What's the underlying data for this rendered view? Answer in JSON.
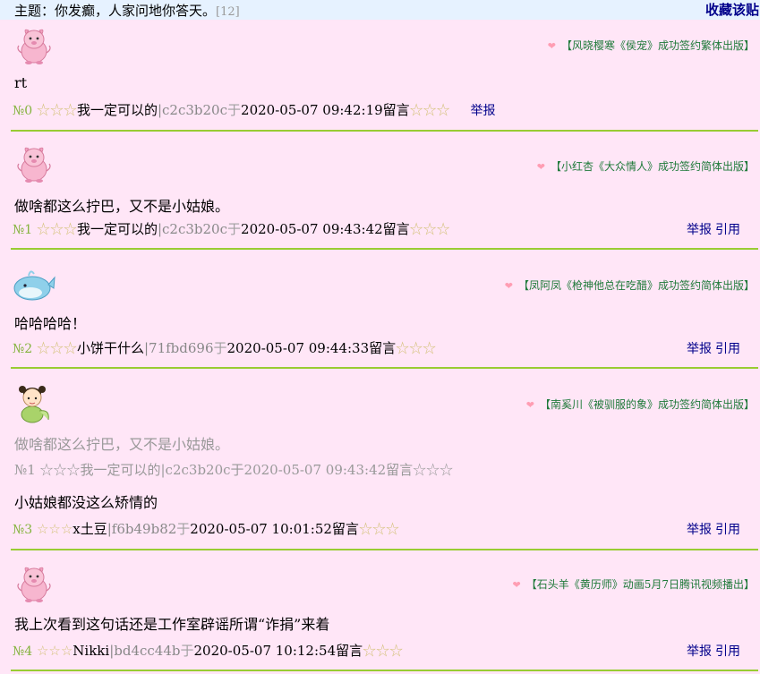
{
  "header": {
    "topic_prefix": "主题：",
    "topic_title": "你发癫，人家问地你答天。",
    "reply_count": "[12]",
    "favorite_label": "收藏该贴"
  },
  "posts": [
    {
      "ad": "【风晓樱寒《侯宠》成功签约繁体出版】",
      "content": "rt",
      "number": "№0",
      "stars_left": "☆☆☆",
      "author": "我一定可以的",
      "hash": "|c2c3b20c",
      "yu": "于",
      "datetime": "2020-05-07 09:42:19",
      "liuyan": "留言",
      "stars_right": "☆☆☆",
      "report": "举报",
      "quote": ""
    },
    {
      "ad": "【小红杏《大众情人》成功签约简体出版】",
      "content": "做啥都这么拧巴，又不是小姑娘。",
      "number": "№1",
      "stars_left": "☆☆☆",
      "author": "我一定可以的",
      "hash": "|c2c3b20c",
      "yu": "于",
      "datetime": "2020-05-07 09:43:42",
      "liuyan": "留言",
      "stars_right": "☆☆☆",
      "report": "举报",
      "quote": "引用"
    },
    {
      "ad": "【凤阿凤《枪神他总在吃醋》成功签约简体出版】",
      "content": "哈哈哈哈！",
      "number": "№2",
      "stars_left": "☆☆☆",
      "author": "小饼干什么",
      "hash": "|71fbd696",
      "yu": "于",
      "datetime": "2020-05-07 09:44:33",
      "liuyan": "留言",
      "stars_right": "☆☆☆",
      "report": "举报",
      "quote": "引用"
    },
    {
      "ad": "【南奚川《被驯服的象》成功签约简体出版】",
      "quoted_content": "做啥都这么拧巴，又不是小姑娘。",
      "quoted_meta": "№1 ☆☆☆我一定可以的|c2c3b20c于2020-05-07 09:43:42留言☆☆☆",
      "content": "小姑娘都没这么矫情的",
      "number": "№3",
      "stars_left": "☆☆☆",
      "author": "x土豆",
      "hash": "|f6b49b82",
      "yu": "于",
      "datetime": "2020-05-07 10:01:52",
      "liuyan": "留言",
      "stars_right": "☆☆☆",
      "report": "举报",
      "quote": "引用"
    },
    {
      "ad": "【石头羊《黄历师》动画5月7日腾讯视频播出】",
      "content": "我上次看到这句话还是工作室辟谣所谓“诈捐”来着",
      "number": "№4",
      "stars_left": "☆☆☆",
      "author": "Nikki",
      "hash": "|bd4cc44b",
      "yu": "于",
      "datetime": "2020-05-07 10:12:54",
      "liuyan": "留言",
      "stars_right": "☆☆☆",
      "report": "举报",
      "quote": "引用"
    }
  ],
  "icons": {
    "avatar_0": "pink-pig-avatar-icon",
    "avatar_1": "pink-pig-avatar-icon",
    "avatar_2": "whale-avatar-icon",
    "avatar_3": "girl-avatar-icon",
    "avatar_4": "pink-pig-avatar-icon",
    "heart": "heart-icon"
  },
  "colors": {
    "page_bg": "#ffe6f7",
    "header_bg": "#e6f2ff",
    "separator": "#99cc33",
    "link": "#00008b",
    "post_number": "#84b33d",
    "ad_text": "#1f7a3a"
  }
}
